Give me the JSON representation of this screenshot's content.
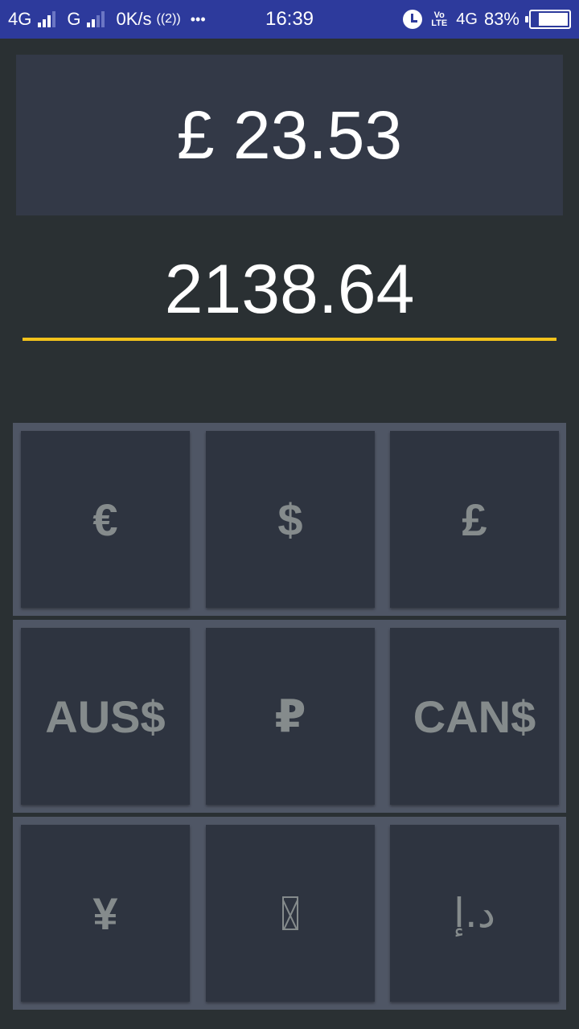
{
  "status_bar": {
    "net1": "4G",
    "net2": "G",
    "speed": "0K/s",
    "hotspot": "((2))",
    "more": "•••",
    "time": "16:39",
    "volte": "Vo LTE",
    "net3": "4G",
    "battery_pct": "83%",
    "battery_level": 0.83
  },
  "converter": {
    "result": "£ 23.53",
    "amount_value": "2138.64"
  },
  "currency_buttons": [
    {
      "symbol": "€"
    },
    {
      "symbol": "$"
    },
    {
      "symbol": "£"
    },
    {
      "symbol": "AUS$"
    },
    {
      "symbol": "₽"
    },
    {
      "symbol": "CAN$"
    },
    {
      "symbol": "¥"
    },
    {
      "symbol": "missing-glyph-icon"
    },
    {
      "symbol": "د.إ"
    }
  ],
  "colors": {
    "status_bar": "#2d3a9c",
    "background": "#2a3033",
    "result_box": "#333947",
    "accent_underline": "#f2c21b",
    "button_bg": "#2e3440",
    "button_text": "#858b8c"
  }
}
